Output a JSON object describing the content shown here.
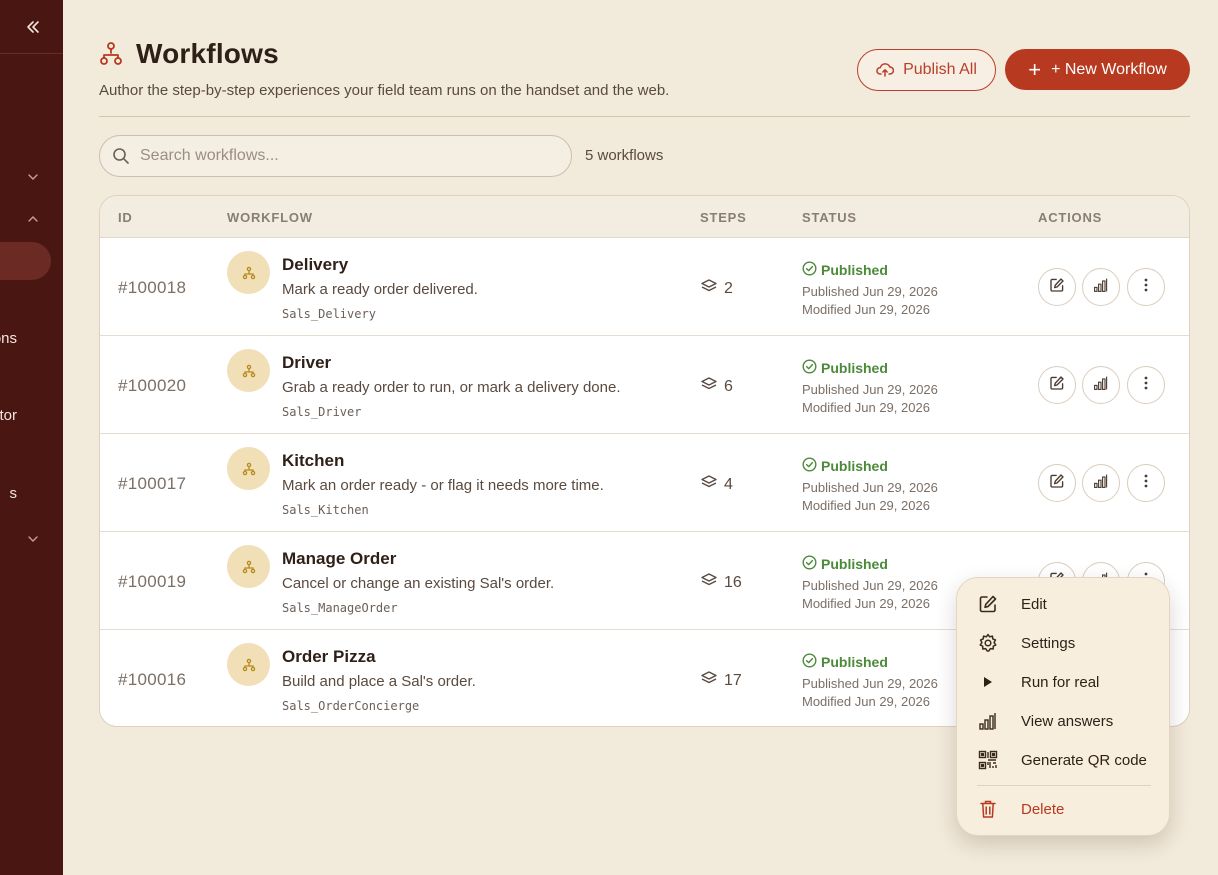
{
  "sidebar": {
    "labels": [
      "ons",
      "ctor",
      "s"
    ]
  },
  "header": {
    "title": "Workflows",
    "subtitle": "Author the step-by-step experiences your field team runs on the handset and the web.",
    "publish_all_label": "Publish All",
    "new_workflow_label": "+ New Workflow"
  },
  "search": {
    "placeholder": "Search workflows...",
    "value": "",
    "count_text": "5 workflows"
  },
  "table": {
    "columns": [
      "ID",
      "WORKFLOW",
      "STEPS",
      "STATUS",
      "ACTIONS"
    ],
    "rows": [
      {
        "id": "#100018",
        "name": "Delivery",
        "description": "Mark a ready order delivered.",
        "code": "Sals_Delivery",
        "steps": "2",
        "status": "Published",
        "published": "Published Jun 29, 2026",
        "modified": "Modified Jun 29, 2026"
      },
      {
        "id": "#100020",
        "name": "Driver",
        "description": "Grab a ready order to run, or mark a delivery done.",
        "code": "Sals_Driver",
        "steps": "6",
        "status": "Published",
        "published": "Published Jun 29, 2026",
        "modified": "Modified Jun 29, 2026"
      },
      {
        "id": "#100017",
        "name": "Kitchen",
        "description": "Mark an order ready - or flag it needs more time.",
        "code": "Sals_Kitchen",
        "steps": "4",
        "status": "Published",
        "published": "Published Jun 29, 2026",
        "modified": "Modified Jun 29, 2026"
      },
      {
        "id": "#100019",
        "name": "Manage Order",
        "description": "Cancel or change an existing Sal's order.",
        "code": "Sals_ManageOrder",
        "steps": "16",
        "status": "Published",
        "published": "Published Jun 29, 2026",
        "modified": "Modified Jun 29, 2026"
      },
      {
        "id": "#100016",
        "name": "Order Pizza",
        "description": "Build and place a Sal's order.",
        "code": "Sals_OrderConcierge",
        "steps": "17",
        "status": "Published",
        "published": "Published Jun 29, 2026",
        "modified": "Modified Jun 29, 2026"
      }
    ]
  },
  "context_menu": {
    "items": [
      {
        "label": "Edit",
        "icon": "edit-icon"
      },
      {
        "label": "Settings",
        "icon": "gear-icon"
      },
      {
        "label": "Run for real",
        "icon": "play-icon"
      },
      {
        "label": "View answers",
        "icon": "bar-chart-icon"
      },
      {
        "label": "Generate QR code",
        "icon": "qr-code-icon"
      },
      {
        "label": "Delete",
        "icon": "trash-icon"
      }
    ]
  },
  "colors": {
    "sidebar_bg": "#4a1612",
    "page_bg": "#f2eadb",
    "accent": "#b7391f",
    "published_green": "#4c8a3a",
    "avatar_bg": "#f1dfb8"
  }
}
